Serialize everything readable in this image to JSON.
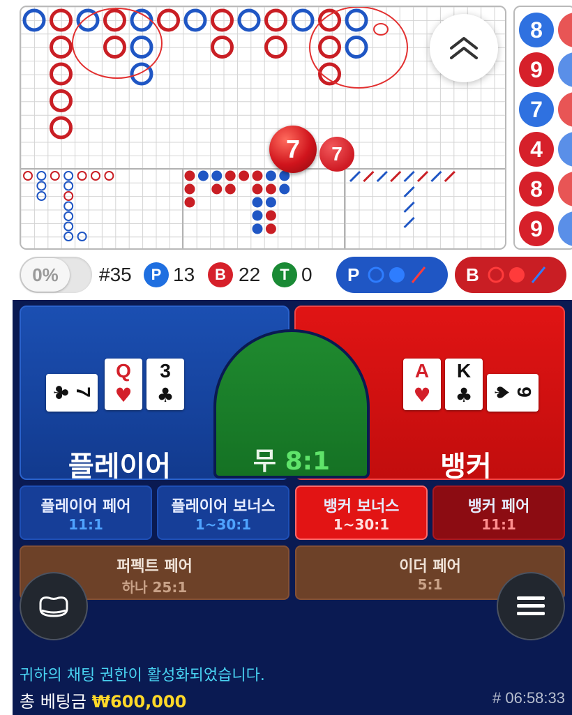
{
  "roadmap": {
    "hot_numbers": [
      "7",
      "7"
    ],
    "side_numbers": [
      "8",
      "9",
      "7",
      "4",
      "8",
      "9"
    ]
  },
  "stats": {
    "percent": "0%",
    "round_label": "#35",
    "player_letter": "P",
    "player_count": "13",
    "banker_letter": "B",
    "banker_count": "22",
    "tie_letter": "T",
    "tie_count": "0",
    "predict_player_letter": "P",
    "predict_banker_letter": "B"
  },
  "colors": {
    "player": "#1f56c4",
    "banker": "#c91e24",
    "tie": "#1f8a2f"
  },
  "table": {
    "player_label": "플레이어",
    "banker_label": "뱅커",
    "tie_label": "무",
    "tie_odds": "8:1",
    "player_cards": [
      {
        "rank": "7",
        "suit": "♣",
        "color": "black"
      },
      {
        "rank": "Q",
        "suit": "♥",
        "color": "red"
      },
      {
        "rank": "3",
        "suit": "♣",
        "color": "black"
      }
    ],
    "banker_cards": [
      {
        "rank": "A",
        "suit": "♥",
        "color": "red"
      },
      {
        "rank": "K",
        "suit": "♣",
        "color": "black"
      },
      {
        "rank": "9",
        "suit": "♠",
        "color": "black"
      }
    ]
  },
  "side_bets": {
    "player_pair": {
      "label": "플레이어 페어",
      "odds": "11:1"
    },
    "player_bonus": {
      "label": "플레이어 보너스",
      "odds": "1~30:1"
    },
    "banker_bonus": {
      "label": "뱅커 보너스",
      "odds": "1~30:1"
    },
    "banker_pair": {
      "label": "뱅커 페어",
      "odds": "11:1"
    },
    "perfect_pair": {
      "label": "퍼펙트 페어",
      "odds": "하나 25:1"
    },
    "either_pair": {
      "label": "이더 페어",
      "odds": "5:1"
    }
  },
  "icons": {
    "scroll_up": "double-chevron-up-icon",
    "chip_tray": "chip-tray-icon",
    "menu": "hamburger-menu-icon"
  },
  "footer": {
    "chat_message": "귀하의 채팅 권한이 활성화되었습니다.",
    "total_bet_label": "총 베팅금",
    "total_bet_amount": "₩600,000",
    "round_id": "# 06:58:33"
  }
}
